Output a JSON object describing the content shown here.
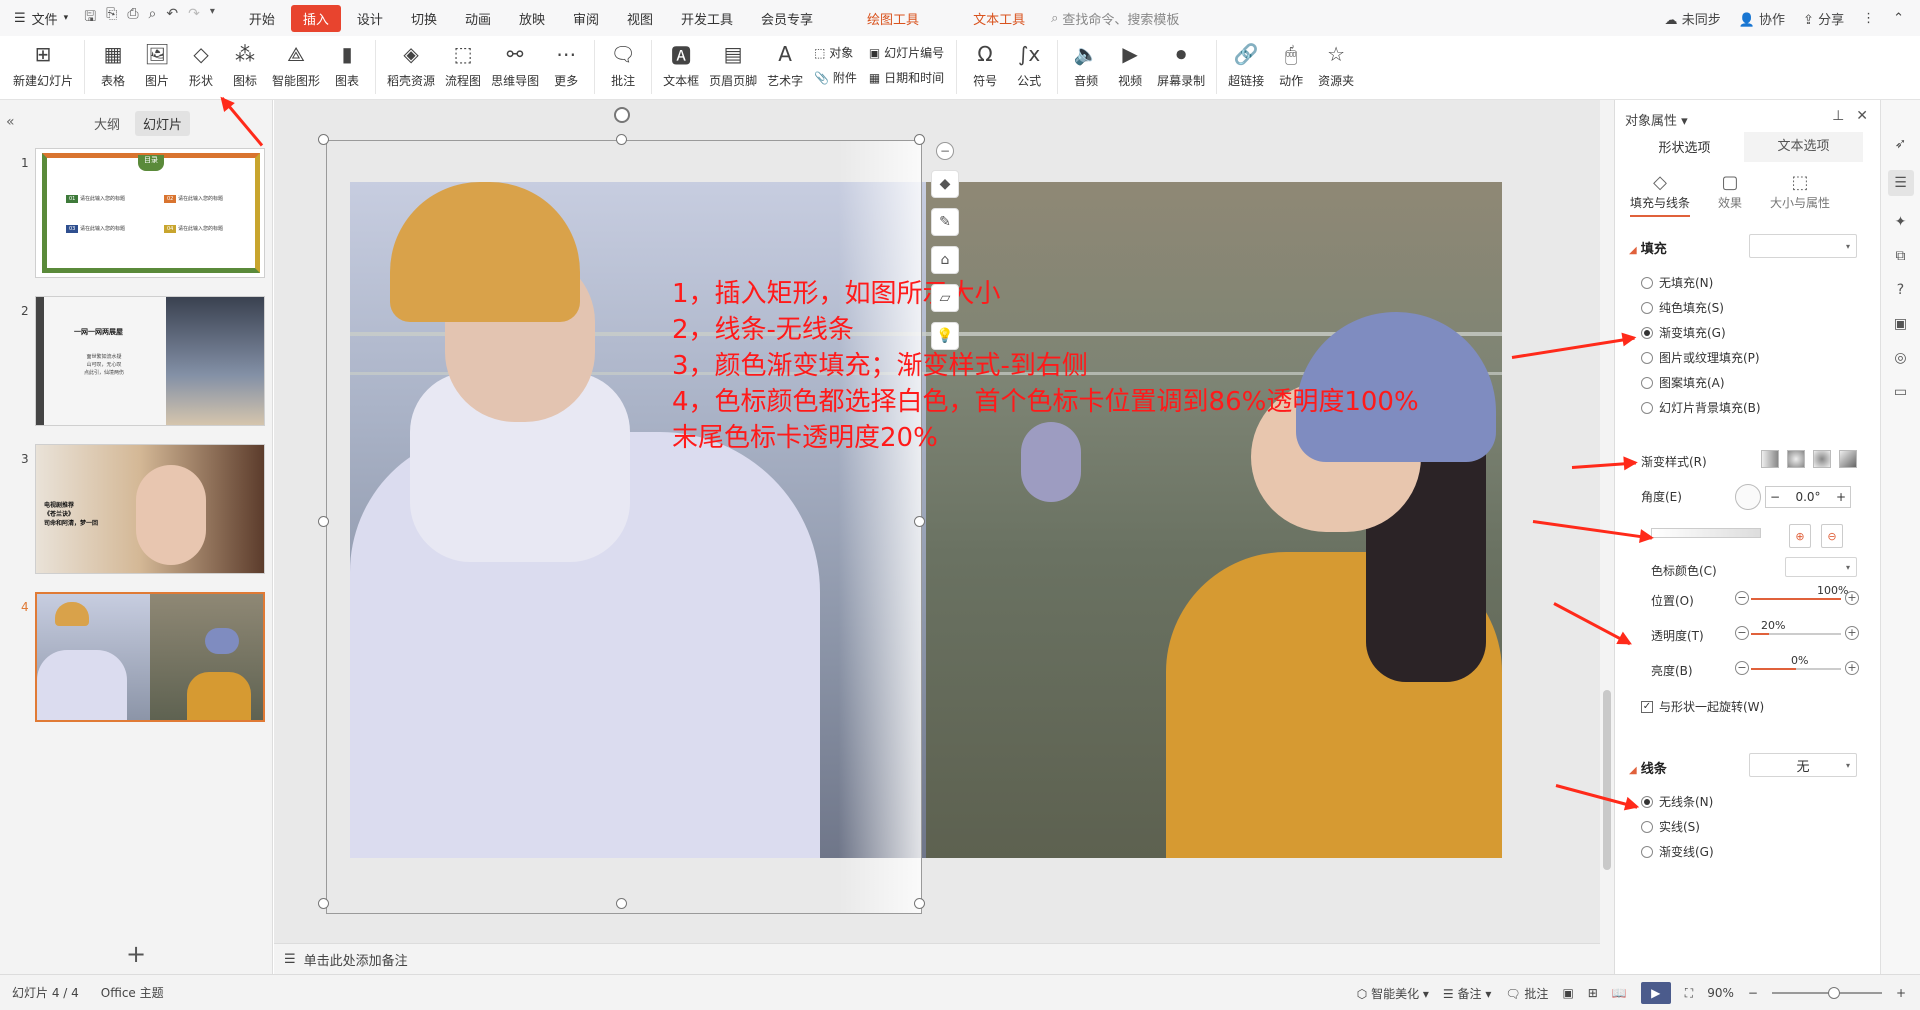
{
  "menubar": {
    "file_label": "文件",
    "tabs": [
      "开始",
      "插入",
      "设计",
      "切换",
      "动画",
      "放映",
      "审阅",
      "视图",
      "开发工具",
      "会员专享"
    ],
    "active_tab": "插入",
    "context_tabs": [
      "绘图工具",
      "文本工具"
    ],
    "search_placeholder": "查找命令、搜索模板",
    "right": {
      "sync": "未同步",
      "collab": "协作",
      "share": "分享"
    }
  },
  "ribbon": {
    "items": [
      "新建幻灯片",
      "表格",
      "图片",
      "形状",
      "图标",
      "智能图形",
      "图表",
      "稻壳资源",
      "流程图",
      "思维导图",
      "更多",
      "批注",
      "文本框",
      "页眉页脚",
      "艺术字"
    ],
    "small_col1": [
      "对象",
      "附件"
    ],
    "small_col2": [
      "幻灯片编号",
      "日期和时间"
    ],
    "items2": [
      "符号",
      "公式",
      "音频",
      "视频",
      "屏幕录制",
      "超链接",
      "动作",
      "资源夹"
    ]
  },
  "leftpane": {
    "tab_outline": "大纲",
    "tab_slides": "幻灯片",
    "slides": [
      {
        "num": "1",
        "title": "目录",
        "items": [
          "请在此输入您的标题",
          "请在此输入您的标题",
          "请在此输入您的标题",
          "请在此输入您的标题"
        ],
        "nums": [
          "01",
          "02",
          "03",
          "04"
        ]
      },
      {
        "num": "2",
        "title": "一网一网两展屋",
        "lines": [
          "面世繁如流水疑",
          "山可叹，无心叹",
          "点此引，仙境两伤"
        ]
      },
      {
        "num": "3",
        "title": "电视剧推荐",
        "lines": [
          "《苍兰诀》",
          "司命和阿清，梦一回"
        ]
      },
      {
        "num": "4"
      }
    ]
  },
  "slide": {
    "instructions": [
      "1，插入矩形，如图所示大小",
      "2，线条-无线条",
      "3，颜色渐变填充；渐变样式-到右侧",
      "4，色标颜色都选择白色，首个色标卡位置调到86%透明度100%",
      "末尾色标卡透明度20%"
    ]
  },
  "notes_placeholder": "单击此处添加备注",
  "rightpane": {
    "title": "对象属性",
    "tab_shape": "形状选项",
    "tab_text": "文本选项",
    "subtabs": [
      "填充与线条",
      "效果",
      "大小与属性"
    ],
    "fill_section": "填充",
    "fill_options": [
      "无填充(N)",
      "纯色填充(S)",
      "渐变填充(G)",
      "图片或纹理填充(P)",
      "图案填充(A)",
      "幻灯片背景填充(B)"
    ],
    "fill_selected": "渐变填充(G)",
    "gradient_style_label": "渐变样式(R)",
    "angle_label": "角度(E)",
    "angle_value": "0.0°",
    "stop_color_label": "色标颜色(C)",
    "position_label": "位置(O)",
    "position_value": "100%",
    "transparency_label": "透明度(T)",
    "transparency_value": "20%",
    "brightness_label": "亮度(B)",
    "brightness_value": "0%",
    "rotate_with_shape": "与形状一起旋转(W)",
    "line_section": "线条",
    "line_dropdown": "无",
    "line_options": [
      "无线条(N)",
      "实线(S)",
      "渐变线(G)"
    ],
    "line_selected": "无线条(N)"
  },
  "statusbar": {
    "slide_info": "幻灯片 4 / 4",
    "theme": "Office 主题",
    "smart": "智能美化",
    "notes": "备注",
    "comments": "批注",
    "zoom": "90%"
  },
  "colors": {
    "accent": "#e8442e",
    "annotation_red": "#ff1a1a",
    "selected_thumb": "#e07a35"
  }
}
